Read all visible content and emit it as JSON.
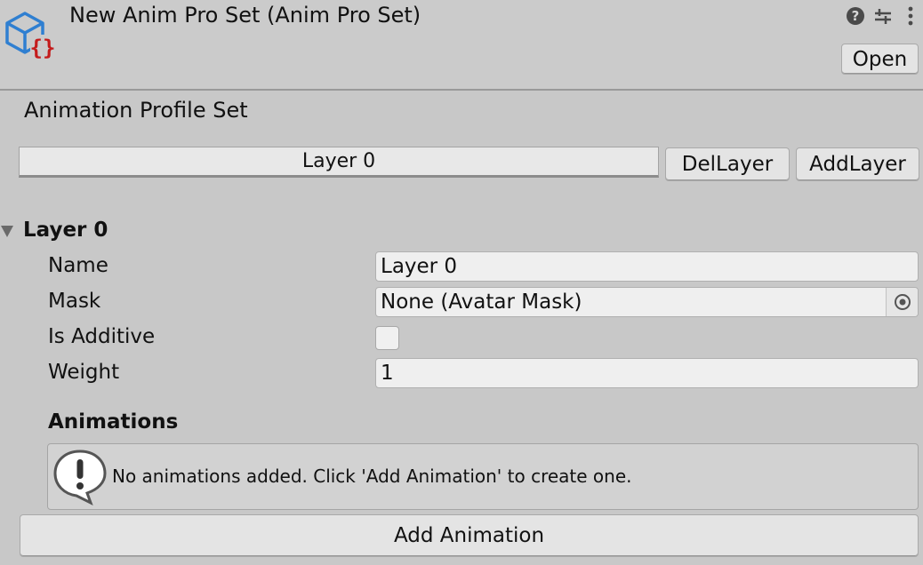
{
  "header": {
    "title": "New Anim Pro Set (Anim Pro Set)",
    "asset_icon": "script-asset-cube-icon",
    "icons": [
      "help-icon",
      "preset-sliders-icon",
      "more-vertical-icon"
    ],
    "open_label": "Open"
  },
  "profile_set": {
    "title": "Animation Profile Set",
    "tab_label": "Layer 0",
    "del_layer_label": "DelLayer",
    "add_layer_label": "AddLayer"
  },
  "layer": {
    "foldout_label": "Layer 0",
    "name_label": "Name",
    "name_value": "Layer 0",
    "mask_label": "Mask",
    "mask_value": "None (Avatar Mask)",
    "is_additive_label": "Is Additive",
    "is_additive_checked": false,
    "weight_label": "Weight",
    "weight_value": "1"
  },
  "animations": {
    "title": "Animations",
    "help_icon": "warning-speech-bubble-icon",
    "help_text": "No animations added. Click 'Add Animation' to create one.",
    "add_label": "Add Animation"
  },
  "colors": {
    "background": "#c8c8c8",
    "cube_blue": "#2f7fd1",
    "brace_red": "#c41c1c",
    "button": "#e4e4e4",
    "field": "#efefef"
  }
}
